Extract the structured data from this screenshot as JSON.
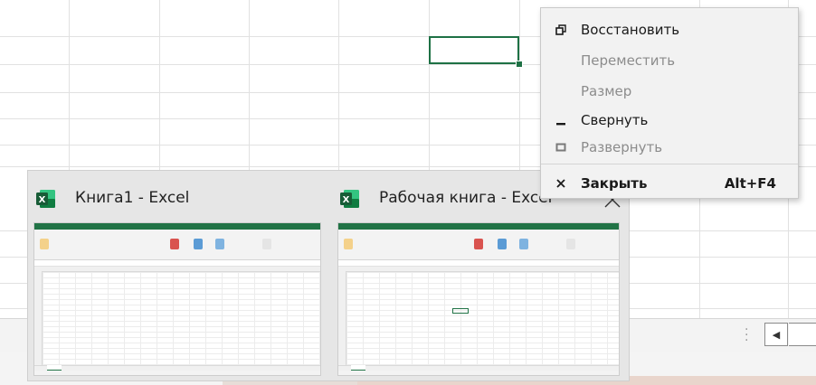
{
  "context_menu": {
    "items": [
      {
        "label": "Восстановить",
        "enabled": true,
        "icon": "restore-icon"
      },
      {
        "label": "Переместить",
        "enabled": false,
        "icon": ""
      },
      {
        "label": "Размер",
        "enabled": false,
        "icon": ""
      },
      {
        "label": "Свернуть",
        "enabled": true,
        "icon": "minimize-icon"
      },
      {
        "label": "Развернуть",
        "enabled": false,
        "icon": "maximize-icon"
      }
    ],
    "close_item": {
      "label": "Закрыть",
      "shortcut": "Alt+F4",
      "icon": "close-icon"
    }
  },
  "taskbar_previews": [
    {
      "title": "Книга1 - Excel",
      "icon": "excel-icon"
    },
    {
      "title": "Рабочая книга - Excel",
      "icon": "excel-icon"
    }
  ],
  "colors": {
    "excel_green": "#217346",
    "selection_green": "#1e7145",
    "menu_bg": "#f2f2f2",
    "disabled_text": "#8c8c8c"
  }
}
